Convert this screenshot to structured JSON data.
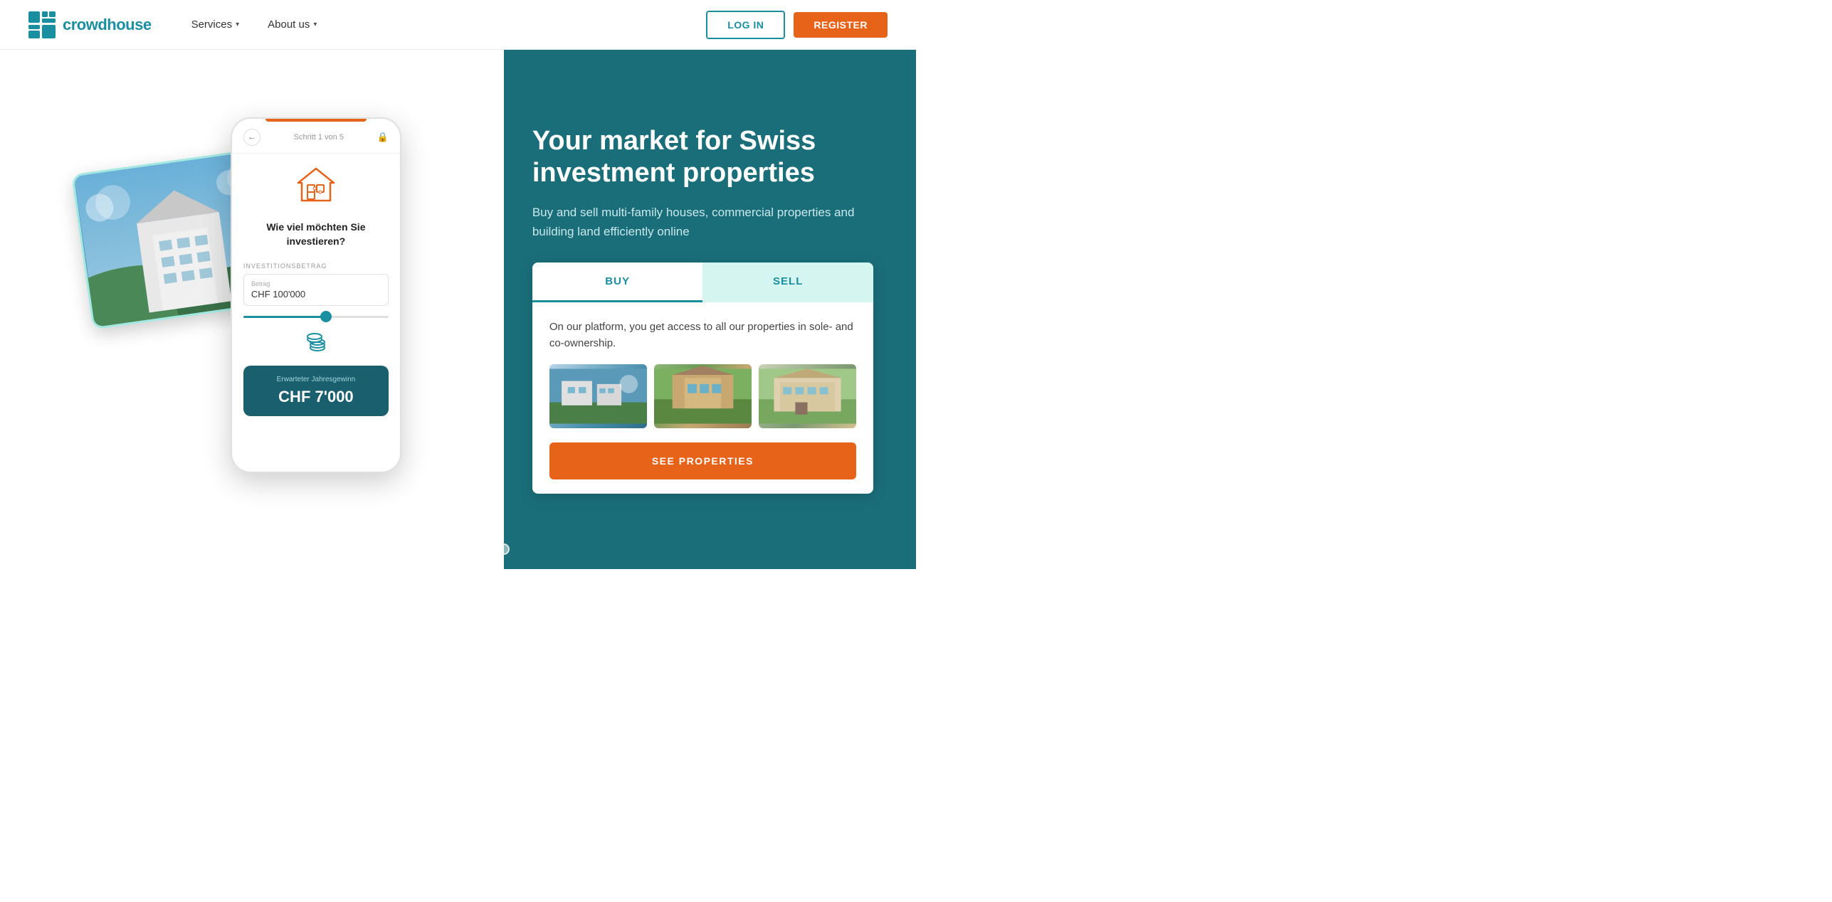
{
  "brand": {
    "name": "crowdhouse",
    "logo_alt": "crowdhouse logo"
  },
  "navbar": {
    "services_label": "Services",
    "about_label": "About us",
    "login_label": "LOG IN",
    "register_label": "REGISTER"
  },
  "hero": {
    "title": "Your market for Swiss investment properties",
    "subtitle": "Buy and sell multi-family houses, commercial properties and building land efficiently online",
    "tabs": {
      "buy": "BUY",
      "sell": "SELL"
    },
    "buy_description": "On our platform, you get access to all our properties in sole- and co-ownership.",
    "see_properties_label": "SEE PROPERTIES"
  },
  "phone": {
    "step_text": "Schritt 1 von 5",
    "question": "Wie viel möchten Sie investieren?",
    "investment_label": "INVESTITIONSBETRAG",
    "amount_label": "Betrag",
    "amount_value": "CHF 100'000",
    "result_label": "Erwarteter Jahresgewinn",
    "result_value": "CHF 7'000"
  },
  "pagination": {
    "dots": [
      {
        "active": false
      },
      {
        "active": false
      },
      {
        "active": false
      },
      {
        "active": true
      },
      {
        "active": false
      }
    ]
  },
  "colors": {
    "teal": "#1a6e7a",
    "teal_light": "#1a8fa0",
    "orange": "#e8631a",
    "mint": "#d4f5f0"
  }
}
